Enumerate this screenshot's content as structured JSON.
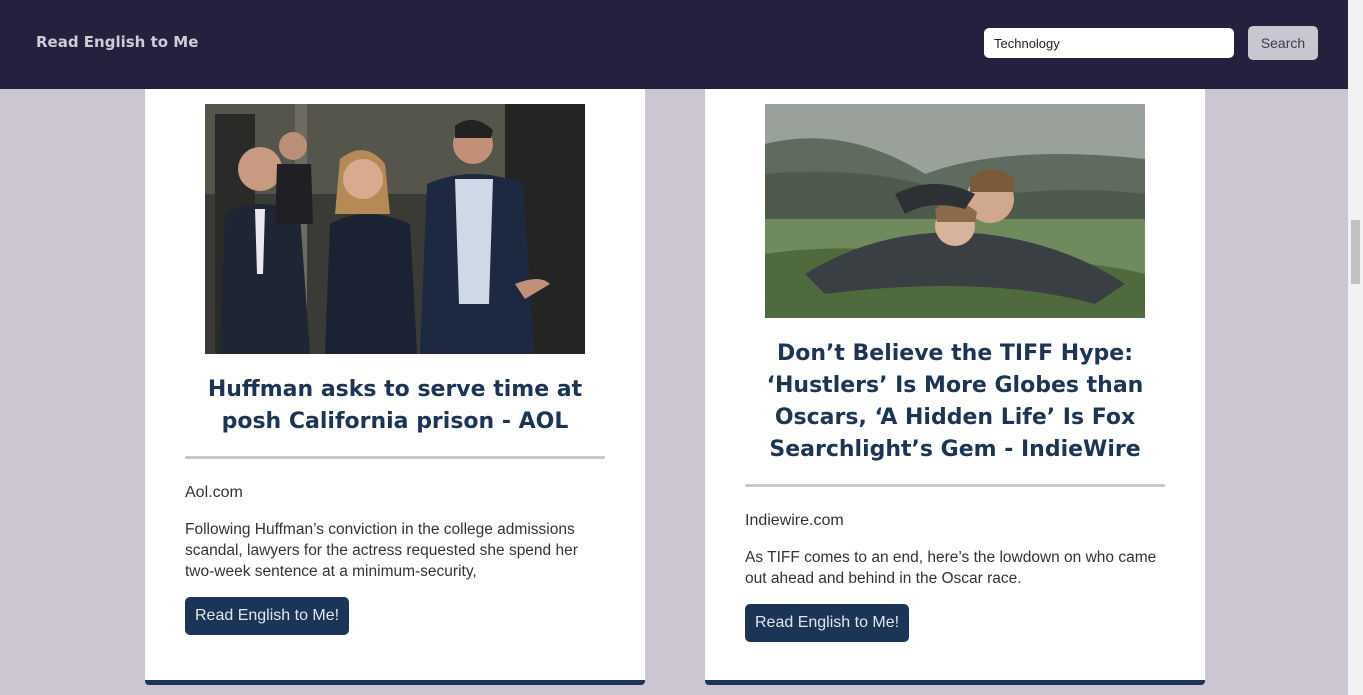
{
  "navbar": {
    "brand": "Read English to Me",
    "search_value": "Technology",
    "search_button": "Search"
  },
  "articles": [
    {
      "title": "Huffman asks to serve time at posh California prison - AOL",
      "source": "Aol.com",
      "description": "Following Huffman’s conviction in the college admissions scandal, lawyers for the actress requested she spend her two-week sentence at a minimum-security,",
      "button": "Read English to Me!"
    },
    {
      "title": "Don’t Believe the TIFF Hype: ‘Hustlers’ Is More Globes than Oscars, ‘A Hidden Life’ Is Fox Searchlight’s Gem - IndieWire",
      "source": "Indiewire.com",
      "description": "As TIFF comes to an end, here’s the lowdown on who came out ahead and behind in the Oscar race.",
      "button": "Read English to Me!"
    }
  ],
  "colors": {
    "navbar": "#25203e",
    "background": "#ccc6d2",
    "accent": "#1b3557"
  }
}
